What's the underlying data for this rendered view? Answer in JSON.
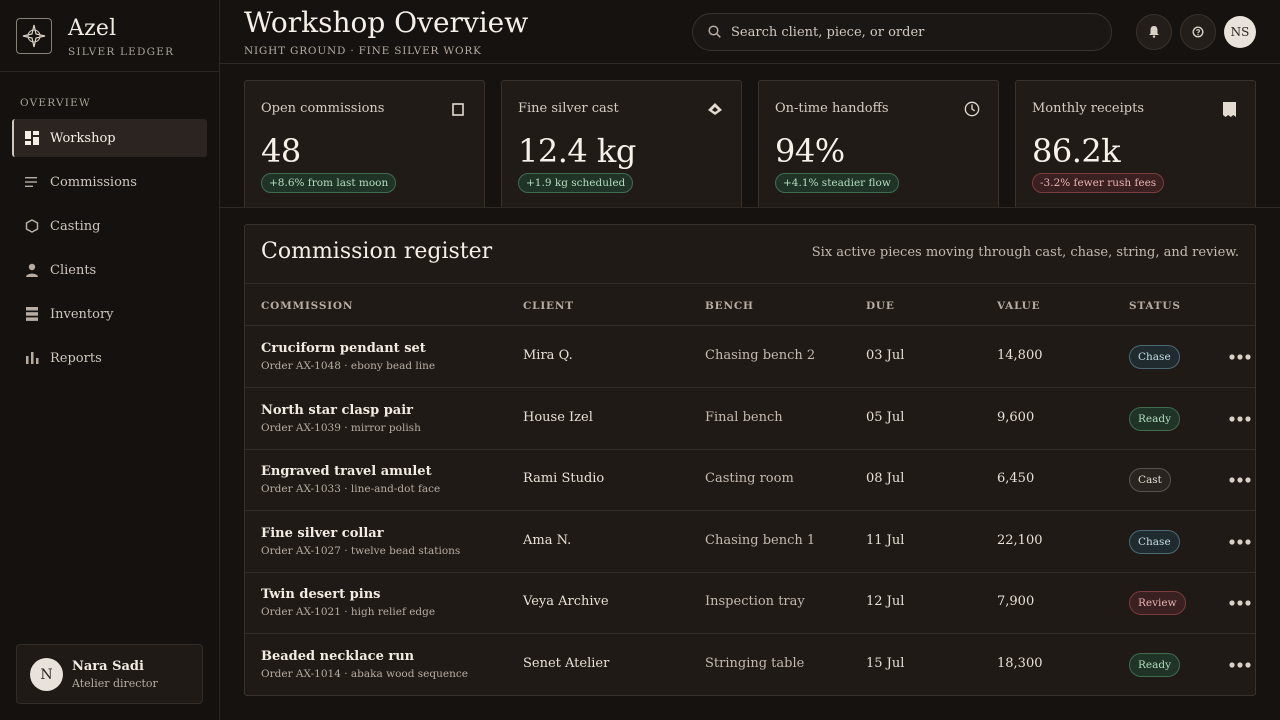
{
  "brand": {
    "name": "Azel",
    "subtitle": "SILVER LEDGER"
  },
  "nav": {
    "section": "OVERVIEW",
    "items": [
      {
        "label": "Workshop",
        "icon": "dashboard-icon",
        "active": true
      },
      {
        "label": "Commissions",
        "icon": "list-icon"
      },
      {
        "label": "Casting",
        "icon": "hexagon-icon"
      },
      {
        "label": "Clients",
        "icon": "person-icon"
      },
      {
        "label": "Inventory",
        "icon": "stack-icon"
      },
      {
        "label": "Reports",
        "icon": "bar-chart-icon"
      }
    ]
  },
  "user": {
    "initial": "N",
    "name": "Nara Sadi",
    "role": "Atelier director"
  },
  "header": {
    "title": "Workshop Overview",
    "subtitle": "NIGHT GROUND · FINE SILVER WORK",
    "search_placeholder": "Search client, piece, or order",
    "avatar_initials": "NS"
  },
  "stats": [
    {
      "label": "Open commissions",
      "value": "48",
      "delta": "+8.6% from last moon",
      "trend": "up",
      "icon": "square-icon"
    },
    {
      "label": "Fine silver cast",
      "value": "12.4 kg",
      "delta": "+1.9 kg scheduled",
      "trend": "up",
      "icon": "ingot-icon"
    },
    {
      "label": "On-time handoffs",
      "value": "94%",
      "delta": "+4.1% steadier flow",
      "trend": "up",
      "icon": "moon-icon"
    },
    {
      "label": "Monthly receipts",
      "value": "86.2k",
      "delta": "-3.2% fewer rush fees",
      "trend": "down",
      "icon": "receipt-icon"
    }
  ],
  "register": {
    "title": "Commission register",
    "description": "Six active pieces moving through cast, chase, string, and review.",
    "columns": [
      "COMMISSION",
      "CLIENT",
      "BENCH",
      "DUE",
      "VALUE",
      "STATUS"
    ],
    "rows": [
      {
        "name": "Cruciform pendant set",
        "order": "Order AX-1048 · ebony bead line",
        "client": "Mira Q.",
        "bench": "Chasing bench 2",
        "due": "03 Jul",
        "value": "14,800",
        "status": "Chase"
      },
      {
        "name": "North star clasp pair",
        "order": "Order AX-1039 · mirror polish",
        "client": "House Izel",
        "bench": "Final bench",
        "due": "05 Jul",
        "value": "9,600",
        "status": "Ready"
      },
      {
        "name": "Engraved travel amulet",
        "order": "Order AX-1033 · line-and-dot face",
        "client": "Rami Studio",
        "bench": "Casting room",
        "due": "08 Jul",
        "value": "6,450",
        "status": "Cast"
      },
      {
        "name": "Fine silver collar",
        "order": "Order AX-1027 · twelve bead stations",
        "client": "Ama N.",
        "bench": "Chasing bench 1",
        "due": "11 Jul",
        "value": "22,100",
        "status": "Chase"
      },
      {
        "name": "Twin desert pins",
        "order": "Order AX-1021 · high relief edge",
        "client": "Veya Archive",
        "bench": "Inspection tray",
        "due": "12 Jul",
        "value": "7,900",
        "status": "Review"
      },
      {
        "name": "Beaded necklace run",
        "order": "Order AX-1014 · abaka wood sequence",
        "client": "Senet Atelier",
        "bench": "Stringing table",
        "due": "15 Jul",
        "value": "18,300",
        "status": "Ready"
      }
    ]
  }
}
